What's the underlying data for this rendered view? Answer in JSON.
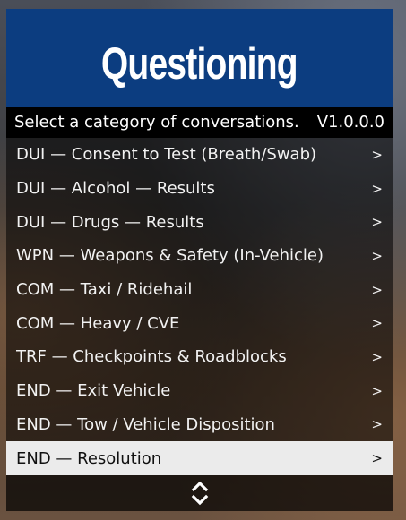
{
  "menu": {
    "title": "Questioning",
    "subtitle": "Select a category of conversations.",
    "version": "V1.0.0.0",
    "items": [
      {
        "label": "DUI — Consent to Test (Breath/Swab)",
        "arrow": ">"
      },
      {
        "label": "DUI — Alcohol — Results",
        "arrow": ">"
      },
      {
        "label": "DUI — Drugs — Results",
        "arrow": ">"
      },
      {
        "label": "WPN — Weapons & Safety (In-Vehicle)",
        "arrow": ">"
      },
      {
        "label": "COM — Taxi / Ridehail",
        "arrow": ">"
      },
      {
        "label": "COM — Heavy / CVE",
        "arrow": ">"
      },
      {
        "label": "TRF — Checkpoints & Roadblocks",
        "arrow": ">"
      },
      {
        "label": "END — Exit Vehicle",
        "arrow": ">"
      },
      {
        "label": "END — Tow / Vehicle Disposition",
        "arrow": ">"
      },
      {
        "label": "END — Resolution",
        "arrow": ">"
      }
    ],
    "selected_index": 9,
    "colors": {
      "banner": "#0c3d80",
      "selected_row": "#ebebeb"
    },
    "nav_icon": "up-down-chevrons-icon"
  }
}
